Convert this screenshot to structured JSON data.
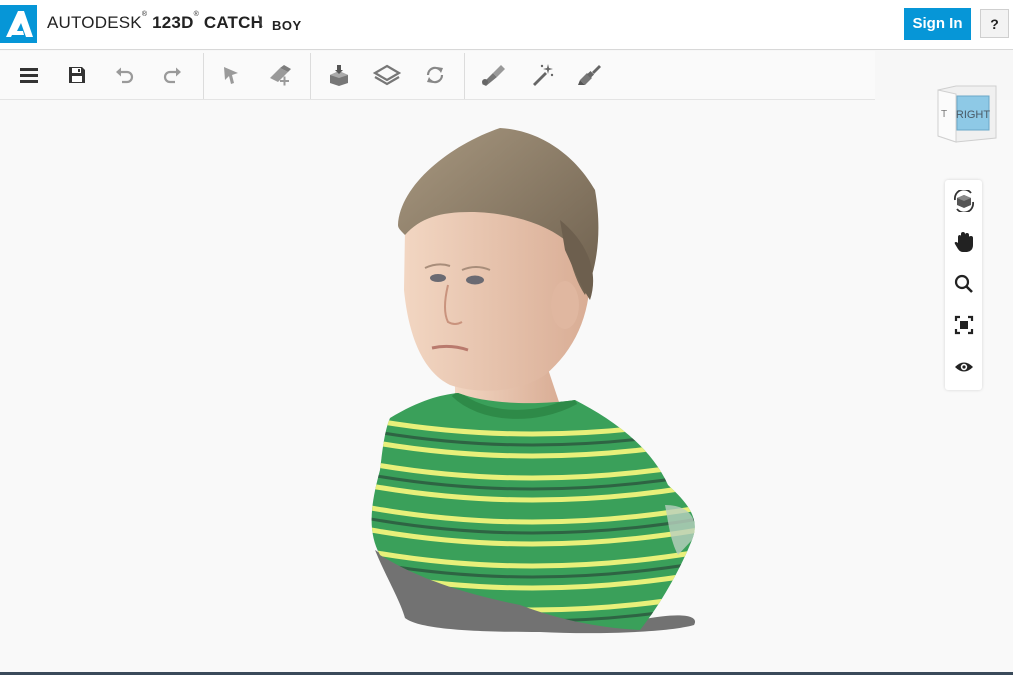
{
  "header": {
    "brand_light": "AUTODESK",
    "brand_reg": "®",
    "brand_bold": "123D",
    "brand_bold_reg": "®",
    "brand_product": "CATCH",
    "separator": "\\",
    "project_name": "BOY",
    "signin_label": "Sign In",
    "help_label": "?"
  },
  "toolbar": {
    "items": [
      {
        "icon": "hamburger-menu-icon"
      },
      {
        "icon": "save-icon"
      },
      {
        "icon": "undo-icon"
      },
      {
        "icon": "redo-icon"
      },
      {
        "icon": "select-arrow-icon"
      },
      {
        "icon": "eraser-add-icon"
      },
      {
        "icon": "cube-drop-icon"
      },
      {
        "icon": "plane-layer-icon"
      },
      {
        "icon": "refresh-icon"
      },
      {
        "icon": "brush-icon"
      },
      {
        "icon": "magic-wand-icon"
      },
      {
        "icon": "paint-broom-icon"
      }
    ]
  },
  "viewcube": {
    "face_label": "RIGHT",
    "side_label": "T"
  },
  "navbar": {
    "items": [
      {
        "icon": "orbit-icon"
      },
      {
        "icon": "pan-hand-icon"
      },
      {
        "icon": "zoom-magnifier-icon"
      },
      {
        "icon": "fit-to-view-icon"
      },
      {
        "icon": "eye-icon"
      }
    ]
  },
  "colors": {
    "accent": "#0696d7",
    "icon": "#444444",
    "icon_disabled": "#9a9a9a",
    "shirt_green": "#3aa05a",
    "shirt_stripe": "#e8f07a",
    "hair": "#8a7a66",
    "skin": "#e9c7b0"
  }
}
